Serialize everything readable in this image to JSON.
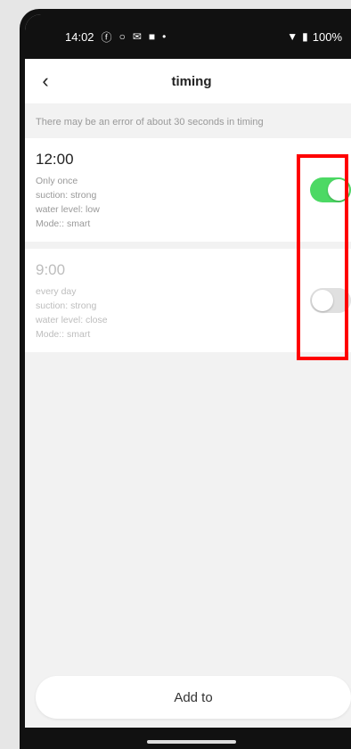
{
  "statusbar": {
    "time": "14:02",
    "icons_left": [
      "facebook-icon",
      "circle-icon",
      "gmail-icon",
      "square-icon",
      "dot-icon"
    ],
    "battery": "100%"
  },
  "header": {
    "title": "timing",
    "back_icon": "chevron-left-icon"
  },
  "hint": "There may be an error of about 30 seconds in timing",
  "timers": [
    {
      "time": "12:00",
      "repeat": "Only once",
      "suction": "suction: strong",
      "water": "water level: low",
      "mode": "Mode:: smart",
      "enabled": true
    },
    {
      "time": "9:00",
      "repeat": "every day",
      "suction": "suction: strong",
      "water": "water level: close",
      "mode": "Mode:: smart",
      "enabled": false
    }
  ],
  "add_button": "Add to",
  "colors": {
    "toggle_on": "#4cd964",
    "highlight": "#ff0000"
  }
}
